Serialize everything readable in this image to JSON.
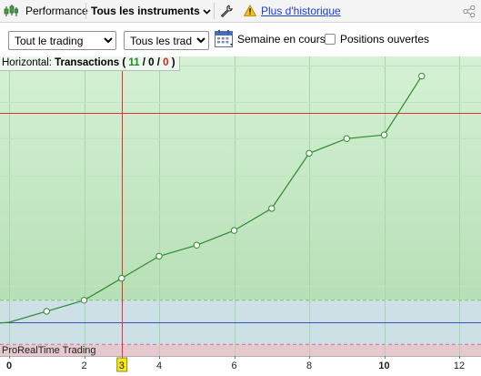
{
  "toolbar": {
    "performance_label": "Performance",
    "instruments_label": "Tous les instruments",
    "history_link": "Plus d'historique"
  },
  "controls": {
    "trading_select": "Tout le trading",
    "trades_select": "Tous les trades",
    "week_label": "Semaine en cours",
    "open_positions_label": "Positions ouvertes"
  },
  "legend": {
    "prefix": "Horizontal:",
    "title": "Transactions",
    "open_paren": "(",
    "wins": "11",
    "slash1": "/",
    "zero": "0",
    "slash2": "/",
    "losses": "0",
    "close_paren": ")"
  },
  "footer_label": "ProRealTime Trading",
  "colors": {
    "line": "#2e8b2e",
    "red_line": "#e83030",
    "blue_line": "#3a4fc0",
    "green_zone": "#c6ecc6",
    "blue_zone": "#cde0e6",
    "pink_zone": "#e6c8cf"
  },
  "chart_data": {
    "type": "line",
    "x": [
      0,
      1,
      2,
      3,
      4,
      5,
      6,
      7,
      8,
      9,
      10,
      11
    ],
    "series": [
      {
        "values": [
          0,
          3,
          6,
          12,
          18,
          21,
          25,
          31,
          46,
          50,
          51,
          67
        ]
      }
    ],
    "x_ticks": [
      "0",
      "2",
      "3",
      "4",
      "6",
      "8",
      "10",
      "12"
    ],
    "cursor_x": 3,
    "xlim": [
      0,
      12
    ],
    "ylim": [
      -6,
      74
    ],
    "reference_levels": {
      "red": 57,
      "blue": 0
    },
    "zone_boundaries": [
      6,
      -6
    ]
  }
}
